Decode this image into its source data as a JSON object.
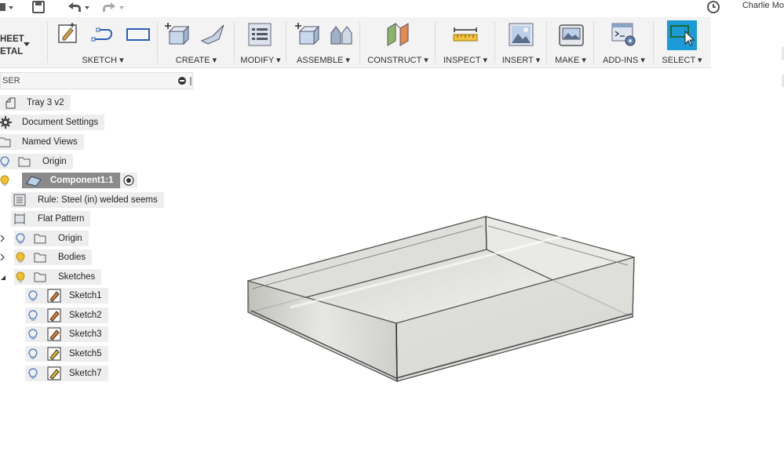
{
  "titlebar": {
    "user_name": "Charlie Mo",
    "icons": [
      "grid-icon",
      "save-icon",
      "undo-icon",
      "redo-icon",
      "clock-icon"
    ]
  },
  "workspace": {
    "line1": "HEET",
    "line2": "ETAL"
  },
  "toolbar": {
    "groups": [
      {
        "label": "SKETCH ▾"
      },
      {
        "label": "CREATE ▾"
      },
      {
        "label": "MODIFY ▾"
      },
      {
        "label": "ASSEMBLE ▾"
      },
      {
        "label": "CONSTRUCT ▾"
      },
      {
        "label": "INSPECT ▾"
      },
      {
        "label": "INSERT ▾"
      },
      {
        "label": "MAKE ▾"
      },
      {
        "label": "ADD-INS ▾"
      },
      {
        "label": "SELECT ▾"
      }
    ],
    "accent_color": "#1a9ad6"
  },
  "browser": {
    "title": "SER",
    "tree": [
      {
        "label": "Tray 3 v2"
      },
      {
        "label": "Document Settings"
      },
      {
        "label": "Named Views"
      },
      {
        "label": "Origin"
      },
      {
        "label": "Component1:1"
      },
      {
        "label": "Rule: Steel (in) welded seems"
      },
      {
        "label": "Flat Pattern"
      },
      {
        "label": "Origin"
      },
      {
        "label": "Bodies"
      },
      {
        "label": "Sketches"
      },
      {
        "label": "Sketch1"
      },
      {
        "label": "Sketch2"
      },
      {
        "label": "Sketch3"
      },
      {
        "label": "Sketch5"
      },
      {
        "label": "Sketch7"
      }
    ]
  }
}
